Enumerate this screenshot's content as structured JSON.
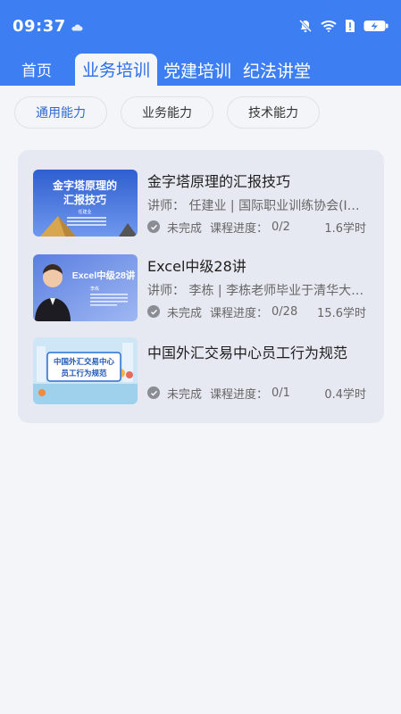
{
  "status_bar": {
    "time": "09:37"
  },
  "tabs": [
    {
      "label": "首页"
    },
    {
      "label": "业务培训"
    },
    {
      "label": "党建培训"
    },
    {
      "label": "纪法讲堂"
    }
  ],
  "filters": [
    {
      "label": "通用能力"
    },
    {
      "label": "业务能力"
    },
    {
      "label": "技术能力"
    }
  ],
  "courses": [
    {
      "title": "金字塔原理的汇报技巧",
      "teacher": "讲师：  任建业 | 国际职业训练协会(IP…",
      "status": "未完成",
      "progress_label": "课程进度：",
      "progress": "0/2",
      "hours": "1.6学时",
      "thumb_text": [
        "金字塔原理的",
        "汇报技巧"
      ],
      "thumb_name": "任建业"
    },
    {
      "title": "Excel中级28讲",
      "teacher": "讲师：  李栋 | 李栋老师毕业于清华大…",
      "status": "未完成",
      "progress_label": "课程进度：",
      "progress": "0/28",
      "hours": "15.6学时",
      "thumb_text": [
        "Excel中级28讲"
      ],
      "thumb_name": "李栋"
    },
    {
      "title": "中国外汇交易中心员工行为规范",
      "teacher": "",
      "status": "未完成",
      "progress_label": "课程进度：",
      "progress": "0/1",
      "hours": "0.4学时",
      "thumb_text": [
        "中国外汇交易中心",
        "员工行为规范"
      ]
    }
  ],
  "colors": {
    "header_blue": "#3d7ff2",
    "active_tab_text": "#2a6fe8",
    "background": "#f4f5f8",
    "card_background": "#e6e9f2"
  }
}
